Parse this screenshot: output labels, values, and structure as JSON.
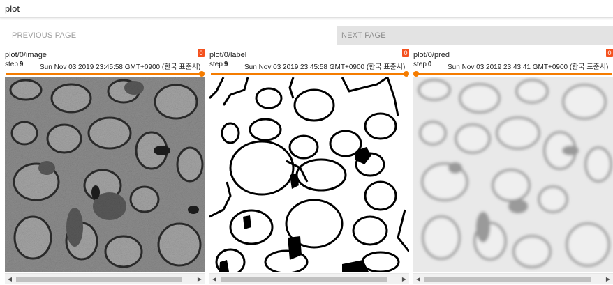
{
  "header": {
    "title": "plot"
  },
  "pager": {
    "previous_label": "PREVIOUS PAGE",
    "next_label": "NEXT PAGE"
  },
  "cards": [
    {
      "title": "plot/0/image",
      "badge": "0",
      "step_label": "step",
      "step_value": "9",
      "timestamp": "Sun Nov 03 2019 23:45:58 GMT+0900 (한국 표준시)",
      "slider_fraction": 1.0,
      "image_kind": "grayscale EM micrograph"
    },
    {
      "title": "plot/0/label",
      "badge": "0",
      "step_label": "step",
      "step_value": "9",
      "timestamp": "Sun Nov 03 2019 23:45:58 GMT+0900 (한국 표준시)",
      "slider_fraction": 1.0,
      "image_kind": "binary segmentation label"
    },
    {
      "title": "plot/0/pred",
      "badge": "0",
      "step_label": "step",
      "step_value": "0",
      "timestamp": "Sun Nov 03 2019 23:43:41 GMT+0900 (한국 표준시)",
      "slider_fraction": 0.0,
      "image_kind": "blurred grayscale prediction"
    }
  ],
  "icons": {
    "scroll_left": "triangle-left-icon",
    "scroll_right": "triangle-right-icon"
  },
  "colors": {
    "accent": "#f57c00",
    "badge": "#f4511e",
    "next_button_bg": "#e3e3e3"
  }
}
